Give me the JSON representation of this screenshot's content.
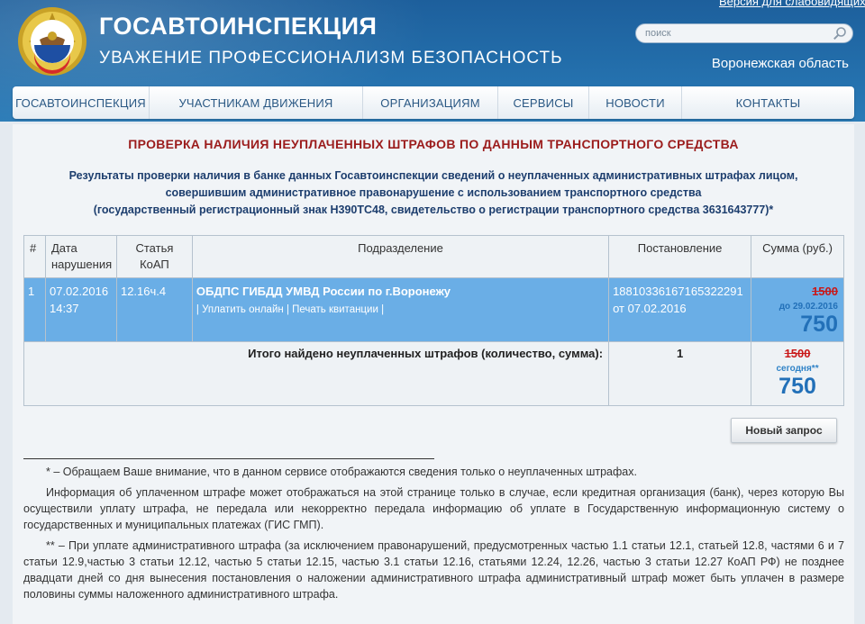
{
  "header": {
    "title": "ГОСАВТОИНСПЕКЦИЯ",
    "motto": "УВАЖЕНИЕ ПРОФЕССИОНАЛИЗМ БЕЗОПАСНОСТЬ",
    "accessible_link": "Версия для слабовидящих",
    "search_placeholder": "поиск",
    "region": "Воронежская область",
    "brand_color": "#1d5f9c"
  },
  "nav": {
    "items": [
      {
        "label": "ГОСАВТОИНСПЕКЦИЯ"
      },
      {
        "label": "УЧАСТНИКАМ ДВИЖЕНИЯ"
      },
      {
        "label": "ОРГАНИЗАЦИЯМ"
      },
      {
        "label": "СЕРВИСЫ"
      },
      {
        "label": "НОВОСТИ"
      },
      {
        "label": "КОНТАКТЫ"
      }
    ]
  },
  "page": {
    "title": "ПРОВЕРКА НАЛИЧИЯ НЕУПЛАЧЕННЫХ ШТРАФОВ ПО ДАННЫМ ТРАНСПОРТНОГО СРЕДСТВА",
    "intro_line1": "Результаты проверки наличия в банке данных Госавтоинспекции сведений о неуплаченных административных штрафах лицом,",
    "intro_line2": "совершившим административное правонарушение с использованием транспортного средства",
    "intro_line3": "(государственный регистрационный знак Н390ТС48, свидетельство о регистрации транспортного средства 3631643777)*"
  },
  "table": {
    "headers": {
      "num": "#",
      "date": "Дата нарушения",
      "article": "Статья КоАП",
      "department": "Подразделение",
      "decree": "Постановление",
      "amount": "Сумма (руб.)"
    },
    "rows": [
      {
        "num": "1",
        "date": "07.02.2016",
        "time": "14:37",
        "article": "12.16ч.4",
        "department": "ОБДПС ГИБДД УМВД России по г.Воронежу",
        "pay_online": "| Уплатить онлайн",
        "print_receipt": "| Печать квитанции |",
        "decree_number": "18810336167165322291",
        "decree_date": "от 07.02.2016",
        "old_amount": "1500",
        "until": "до 29.02.2016",
        "new_amount": "750"
      }
    ],
    "total": {
      "label": "Итого найдено неуплаченных штрафов (количество, сумма):",
      "count": "1",
      "old_amount": "1500",
      "today": "сегодня**",
      "new_amount": "750"
    }
  },
  "new_request_label": "Новый запрос",
  "notes": {
    "note1": "* – Обращаем Ваше внимание, что в данном сервисе отображаются сведения только о неуплаченных штрафах.",
    "note2": "Информация об уплаченном штрафе может отображаться на этой странице только в случае, если кредитная организация (банк), через которую Вы осуществили уплату штрафа, не передала или некорректно передала информацию об уплате в Государственную информационную систему о государственных и муниципальных платежах (ГИС ГМП).",
    "note3": "** – При уплате административного штрафа (за исключением правонарушений, предусмотренных частью 1.1 статьи 12.1, статьей 12.8, частями 6 и 7 статьи 12.9,частью 3 статьи 12.12, частью 5 статьи 12.15, частью 3.1 статьи 12.16, статьями 12.24, 12.26, частью 3 статьи 12.27 КоАП РФ) не позднее двадцати дней со дня вынесения постановления о наложении административного штрафа административный штраф может быть уплачен в размере половины суммы наложенного административного штрафа."
  }
}
